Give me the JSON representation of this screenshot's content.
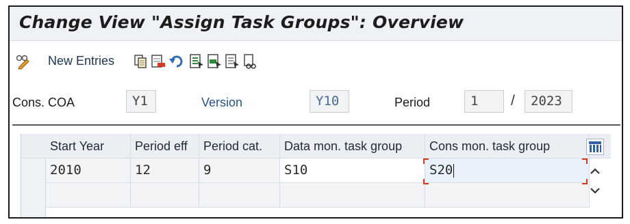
{
  "window": {
    "title": "Change View \"Assign Task Groups\": Overview"
  },
  "toolbar": {
    "new_entries_label": "New Entries",
    "icons": [
      "display-change-icon",
      "copy-icon",
      "delete-icon",
      "undo-icon",
      "select-all-icon",
      "select-block-icon",
      "deselect-all-icon",
      "print-icon"
    ]
  },
  "header": {
    "cons_coa_label": "Cons. COA",
    "cons_coa_value": "Y1",
    "version_label": "Version",
    "version_value": "Y10",
    "period_label": "Period",
    "period_value": "1",
    "period_separator": "/",
    "year_value": "2023"
  },
  "table": {
    "columns": [
      "Start Year",
      "Period eff",
      "Period cat.",
      "Data mon. task group",
      "Cons mon. task group"
    ],
    "rows": [
      {
        "start_year": "2010",
        "period_eff": "12",
        "period_cat": "9",
        "data_mon_task_group": "S10",
        "cons_mon_task_group": "S20"
      }
    ]
  },
  "colors": {
    "accent_red": "#d9371b",
    "link_blue": "#27538c",
    "header_bg": "#ebeff4"
  }
}
